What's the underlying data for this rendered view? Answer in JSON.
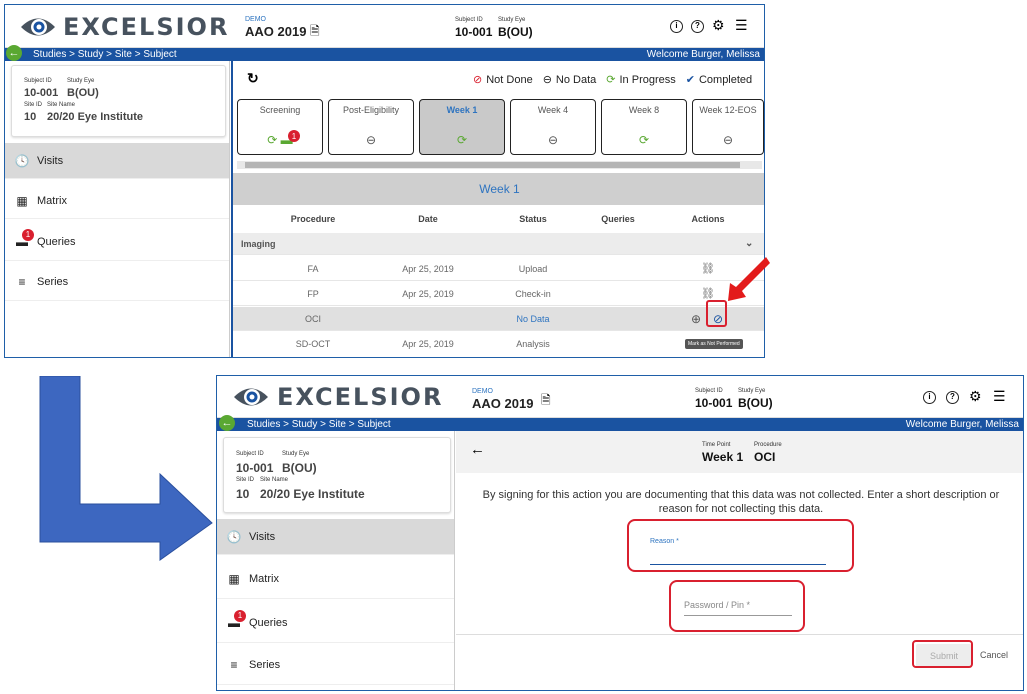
{
  "app": {
    "brand": "EXCELSIOR",
    "demo_label": "DEMO",
    "study": "AAO 2019"
  },
  "subject": {
    "subject_id_label": "Subject ID",
    "study_eye_label": "Study Eye",
    "subject_id": "10-001",
    "study_eye": "B(OU)",
    "site_id_label": "Site ID",
    "site_name_label": "Site Name",
    "site_id": "10",
    "site_name": "20/20 Eye Institute"
  },
  "breadcrumb": "Studies > Study > Site > Subject",
  "welcome": "Welcome Burger, Melissa",
  "sidebar": {
    "items": [
      {
        "label": "Visits",
        "icon": "clock-icon"
      },
      {
        "label": "Matrix",
        "icon": "grid-icon"
      },
      {
        "label": "Queries",
        "icon": "chat-icon",
        "badge": "1"
      },
      {
        "label": "Series",
        "icon": "list-icon"
      }
    ]
  },
  "legend": {
    "not_done": "Not Done",
    "no_data": "No Data",
    "in_progress": "In Progress",
    "completed": "Completed"
  },
  "timepoints": [
    {
      "label": "Screening",
      "badge": "1"
    },
    {
      "label": "Post-Eligibility"
    },
    {
      "label": "Week 1"
    },
    {
      "label": "Week 4"
    },
    {
      "label": "Week 8"
    },
    {
      "label": "Week 12-EOS"
    }
  ],
  "visit": {
    "title": "Week 1",
    "columns": [
      "Procedure",
      "Date",
      "Status",
      "Queries",
      "Actions"
    ],
    "group": "Imaging",
    "rows": [
      {
        "procedure": "FA",
        "date": "Apr 25, 2019",
        "status": "Upload"
      },
      {
        "procedure": "FP",
        "date": "Apr 25, 2019",
        "status": "Check-in"
      },
      {
        "procedure": "OCI",
        "date": "",
        "status": "No Data"
      },
      {
        "procedure": "SD-OCT",
        "date": "Apr 25, 2019",
        "status": "Analysis"
      }
    ],
    "tooltip": "Mark as Not Performed"
  },
  "form": {
    "time_point_label": "Time Point",
    "procedure_label": "Procedure",
    "time_point": "Week 1",
    "procedure": "OCI",
    "message": "By signing for this action you are documenting that this data was not collected. Enter a short description or reason for not collecting this data.",
    "reason_label": "Reason *",
    "password_placeholder": "Password / Pin *",
    "submit": "Submit",
    "cancel": "Cancel"
  },
  "colors": {
    "brand_blue": "#1a53a1",
    "red": "#d9202f",
    "green": "#5aa832",
    "arrow_blue": "#3d67c0"
  }
}
